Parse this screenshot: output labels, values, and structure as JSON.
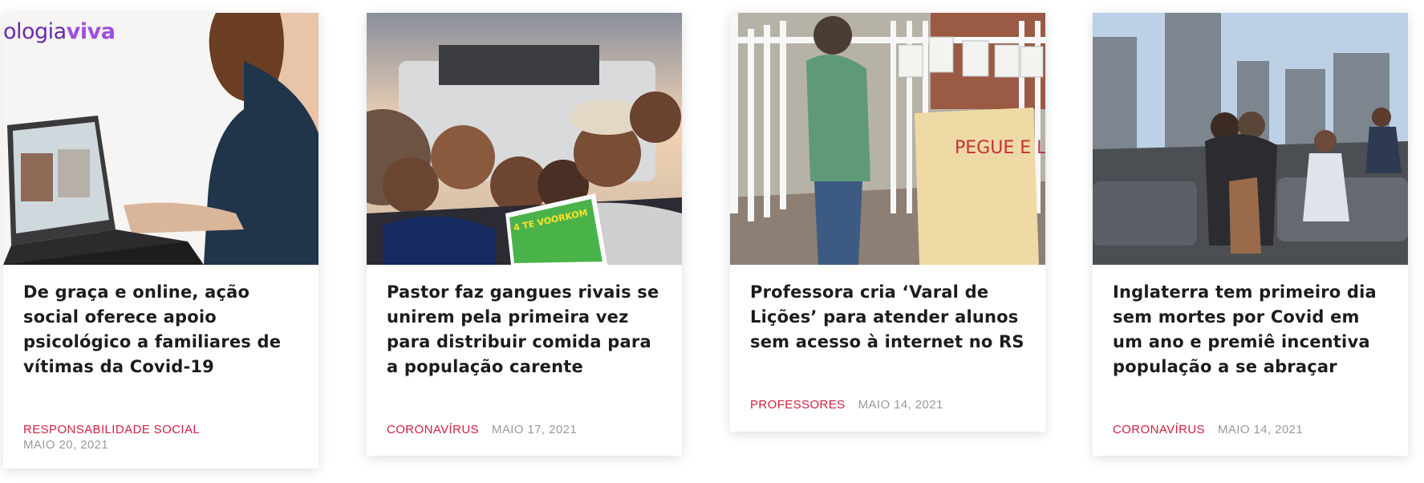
{
  "cards": [
    {
      "image_alt": "Mulher em videochamada no notebook",
      "brand_prefix": "ologia",
      "brand_suffix": "viva",
      "title": "De graça e online, ação social oferece apoio psicológico a familiares de vítimas da Covid-19",
      "category": "RESPONSABILIDADE SOCIAL",
      "date": "MAIO 20, 2021"
    },
    {
      "image_alt": "Grupo de jovens sorrindo segurando cartaz",
      "poster_text": "4 TE VOORKOM",
      "title": "Pastor faz gangues rivais se unirem pela primeira vez para distribuir comida para a população carente",
      "category": "CORONAVÍRUS",
      "date": "MAIO 17, 2021"
    },
    {
      "image_alt": "Professora pendurando atividades em um varal na grade",
      "sign_text": "PEGUE E LEVE ALUNOS",
      "title": "Professora cria ‘Varal de Lições’ para atender alunos sem acesso à internet no RS",
      "category": "PROFESSORES",
      "date": "MAIO 14, 2021"
    },
    {
      "image_alt": "Pessoas se abraçando em terraço na cidade",
      "title": "Inglaterra tem primeiro dia sem mortes por Covid em um ano e premiê incentiva população a se abraçar",
      "category": "CORONAVÍRUS",
      "date": "MAIO 14, 2021"
    }
  ],
  "colors": {
    "category": "#d0213f",
    "date": "#9a9a9a",
    "title": "#1c1c1c"
  }
}
